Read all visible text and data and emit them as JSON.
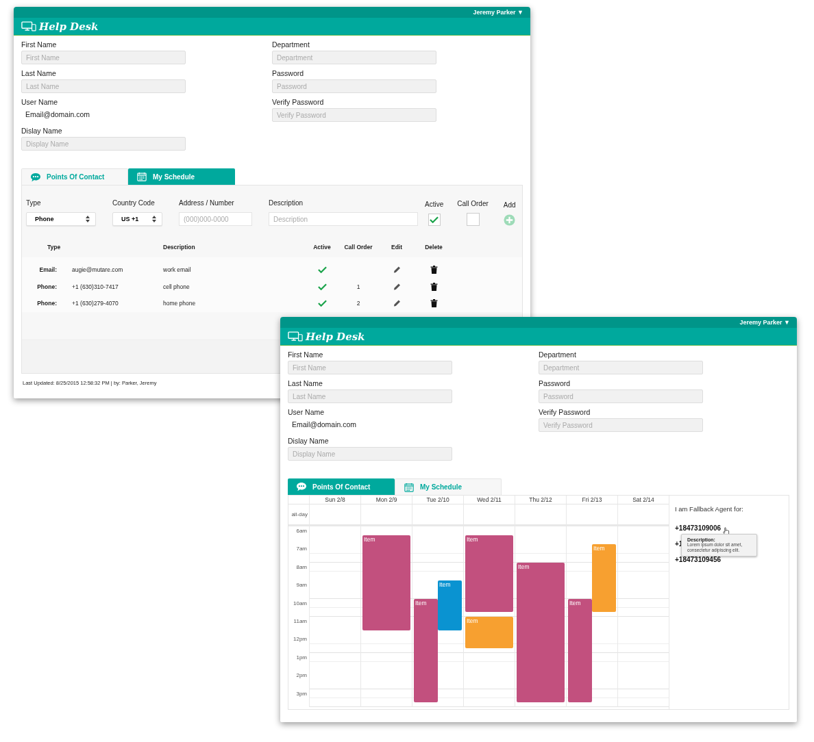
{
  "windows": [
    {
      "user": "Jeremy Parker",
      "user_caret": "▼",
      "title": "Help Desk",
      "form": {
        "left": [
          {
            "label": "First Name",
            "placeholder": "First Name"
          },
          {
            "label": "Last Name",
            "placeholder": "Last Name"
          },
          {
            "label": "User Name",
            "value": "Email@domain.com"
          },
          {
            "label": "Dislay Name",
            "placeholder": "Display Name"
          }
        ],
        "right": [
          {
            "label": "Department",
            "placeholder": "Department"
          },
          {
            "label": "Password",
            "placeholder": "Password"
          },
          {
            "label": "Verify Password",
            "placeholder": "Verify Password"
          }
        ]
      },
      "tabs": [
        {
          "label": "Points Of Contact",
          "selected": true,
          "kind": "contacts"
        },
        {
          "label": "My Schedule",
          "selected": false,
          "kind": "schedule"
        }
      ],
      "panel": {
        "kind": "contacts",
        "new_contact": {
          "type_label": "Type",
          "type_value": "Phone",
          "country_label": "Country Code",
          "country_value": "US +1",
          "address_label": "Address / Number",
          "address_placeholder": "(000)000-0000",
          "description_label": "Description",
          "description_placeholder": "Description",
          "active_label": "Active",
          "active_checked": true,
          "call_order_label": "Call Order",
          "add_label": "Add"
        },
        "columns": [
          "Type",
          "Description",
          "Active",
          "Call Order",
          "Edit",
          "Delete"
        ],
        "rows": [
          {
            "type": "Email:",
            "address": "augie@mutare.com",
            "description": "work email",
            "active": true
          },
          {
            "type": "Phone:",
            "address": "+1 (630)310-7417",
            "description": "cell phone",
            "active": true,
            "call_order": "1"
          },
          {
            "type": "Phone:",
            "address": "+1 (630)279-4070",
            "description": "home phone",
            "active": true,
            "call_order": "2"
          }
        ]
      },
      "footer": "Last Updated: 8/25/2015 12:58:32 PM | by: Parker, Jeremy"
    },
    {
      "user": "Jeremy Parker",
      "user_caret": "▼",
      "title": "Help Desk",
      "form": {
        "left": [
          {
            "label": "First Name",
            "placeholder": "First Name"
          },
          {
            "label": "Last Name",
            "placeholder": "Last Name"
          },
          {
            "label": "User Name",
            "value": "Email@domain.com"
          },
          {
            "label": "Dislay Name",
            "placeholder": "Display Name"
          }
        ],
        "right": [
          {
            "label": "Department",
            "placeholder": "Department"
          },
          {
            "label": "Password",
            "placeholder": "Password"
          },
          {
            "label": "Verify Password",
            "placeholder": "Verify Password"
          }
        ]
      },
      "tabs": [
        {
          "label": "Points Of Contact",
          "selected": false,
          "kind": "contacts"
        },
        {
          "label": "My Schedule",
          "selected": true,
          "kind": "schedule"
        }
      ],
      "panel": {
        "kind": "schedule",
        "all_day_label": "all-day",
        "hours": [
          "6am",
          "7am",
          "8am",
          "9am",
          "10am",
          "11am",
          "12pm",
          "1pm",
          "2pm",
          "3pm"
        ],
        "days": [
          {
            "label": "Sun 2/8"
          },
          {
            "label": "Mon 2/9",
            "events": [
              {
                "label": "Item",
                "color": "#c2507e"
              }
            ]
          },
          {
            "label": "Tue 2/10",
            "events": [
              {
                "label": "Item",
                "color": "#c2507e"
              },
              {
                "label": "Item",
                "color": "#0a93d1"
              }
            ]
          },
          {
            "label": "Wed 2/11",
            "events": [
              {
                "label": "Item",
                "color": "#c2507e"
              },
              {
                "label": "Item",
                "color": "#f7a030"
              }
            ]
          },
          {
            "label": "Thu 2/12",
            "events": [
              {
                "label": "Item",
                "color": "#c2507e"
              }
            ]
          },
          {
            "label": "Fri 2/13",
            "events": [
              {
                "label": "Item",
                "color": "#c2507e"
              },
              {
                "label": "Item",
                "color": "#f7a030"
              }
            ]
          },
          {
            "label": "Sat 2/14"
          }
        ],
        "fallback": {
          "heading": "I am Fallback Agent for:",
          "numbers": [
            "+18473109006",
            "+1",
            "+18473109456"
          ],
          "tooltip": {
            "title": "Description:",
            "text": "Lorem ipsum dolor sit amet, consectetur adipiscing elit."
          }
        }
      }
    }
  ]
}
